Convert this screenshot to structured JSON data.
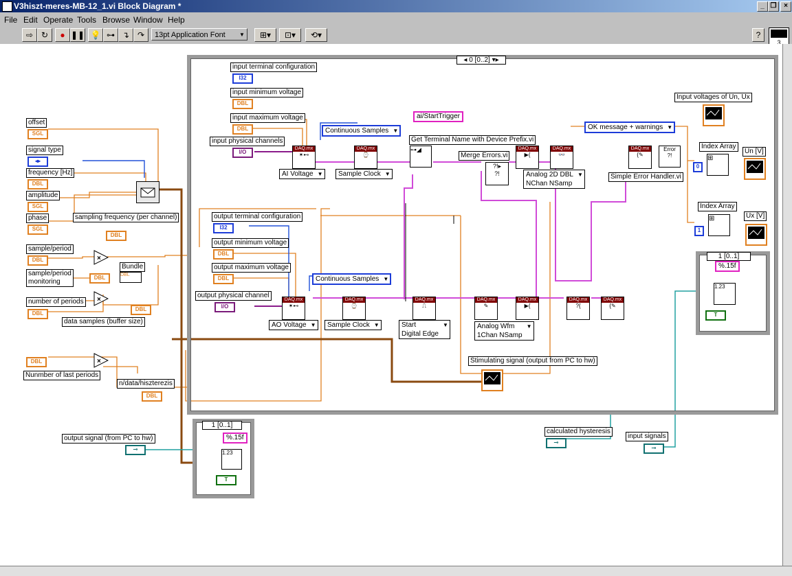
{
  "window": {
    "title": "V3hiszt-meres-MB-12_1.vi Block Diagram *"
  },
  "menubar": {
    "items": [
      "File",
      "Edit",
      "Operate",
      "Tools",
      "Browse",
      "Window",
      "Help"
    ]
  },
  "toolbar": {
    "font_select": "13pt Application Font",
    "help": "?"
  },
  "corner_icon_num": "3",
  "sequences": {
    "main_header": "0 [0..2]",
    "right_header": "1 [0..1]",
    "bottom_header": "1 [0..1]"
  },
  "controls": {
    "offset": "offset",
    "signal_type": "signal type",
    "frequency": "frequency [Hz]",
    "amplitude": "amplitude",
    "phase": "phase",
    "sampling_frequency": "sampling frequency (per channel)",
    "sample_period": "sample/period",
    "sample_period_monitoring": "sample/period\nmonitoring",
    "bundle": "Bundle",
    "number_of_periods": "number of periods",
    "data_samples": "data samples (buffer size)",
    "number_of_last_periods": "Nunmber of last periods",
    "n_data_hiszterezis": "n/data/hiszterezis",
    "output_signal": "output signal  (from PC to hw)",
    "calculated_hysteresis": "calculated hysteresis",
    "input_signals": "input signals"
  },
  "types": {
    "sgl": "SGL",
    "dbl": "DBL",
    "i32": "I32",
    "io": "I/O",
    "enum": "◂▸",
    "bool": "T",
    "str": "%.15f",
    "num123": "1.23",
    "zero": "0",
    "one": "1"
  },
  "inner": {
    "input_terminal_configuration": "input terminal configuration",
    "input_minimum_voltage": "input minimum voltage",
    "input_maximum_voltage": "input maximum voltage",
    "input_physical_channels": "input physical channels",
    "ai_voltage": "AI Voltage",
    "continuous_samples_1": "Continuous Samples",
    "sample_clock_1": "Sample Clock",
    "ai_start_trigger": "ai/StartTrigger",
    "get_terminal_name": "Get Terminal Name with Device Prefix.vi",
    "merge_errors": "Merge Errors.vi",
    "analog_2d": "Analog 2D DBL\nNChan NSamp",
    "ok_message": "OK message + warnings",
    "simple_error_handler": "Simple Error Handler.vi",
    "input_voltages": "Input voltages of Un, Ux",
    "index_array_1": "Index Array",
    "un_v": "Un [V]",
    "index_array_2": "Index Array",
    "ux_v": "Ux [V]",
    "output_terminal_configuration": "output terminal configuration",
    "output_minimum_voltage": "output minimum voltage",
    "output_maximum_voltage": "output maximum voltage",
    "output_physical_channel": "output physical channel",
    "ao_voltage": "AO Voltage",
    "continuous_samples_2": "Continuous Samples",
    "sample_clock_2": "Sample Clock",
    "start_digital_edge": "Start\nDigital Edge",
    "analog_wfm": "Analog Wfm\n1Chan NSamp",
    "stimulating_signal": "Stimulating signal (output from PC to hw)",
    "daqmx": "DAQ.mx",
    "error_text": "Error\n?!"
  }
}
